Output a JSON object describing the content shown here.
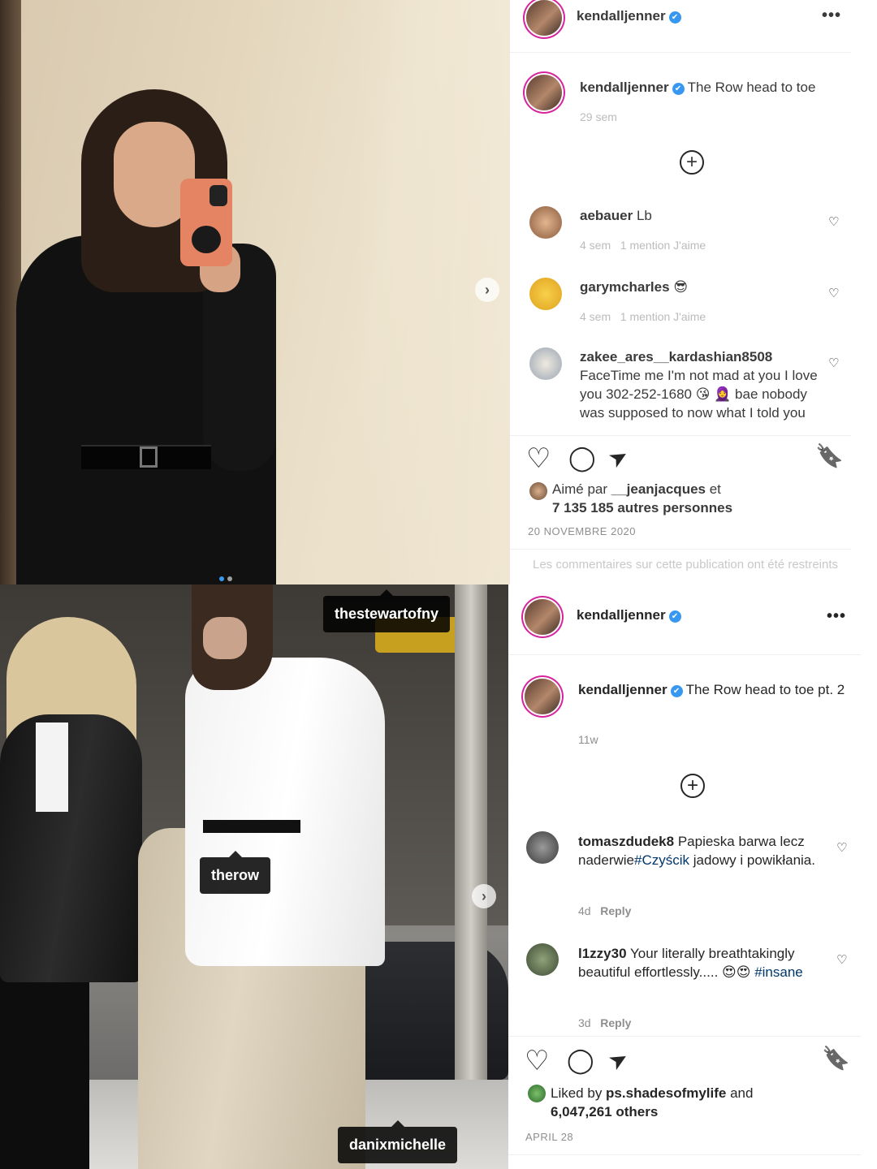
{
  "post1": {
    "header": {
      "username": "kendalljenner",
      "more_label": "•••"
    },
    "caption": {
      "username": "kendalljenner",
      "text": "The Row head to toe",
      "time": "29 sem"
    },
    "add_label": "+",
    "comments": [
      {
        "username": "aebauer",
        "text": "Lb",
        "time": "4 sem",
        "likes": "1 mention J'aime"
      },
      {
        "username": "garymcharles",
        "text": "😎",
        "time": "4 sem",
        "likes": "1 mention J'aime"
      },
      {
        "username": "zakee_ares__kardashian8508",
        "text": "FaceTime me I'm not mad at you I love you 302-252-1680 😘 🧕 bae nobody was supposed to now what I told you"
      }
    ],
    "likes": {
      "prefix": "Aimé par ",
      "user": "__jeanjacques",
      "suffix": " et",
      "count": "7 135 185 autres personnes"
    },
    "date": "20 NOVEMBRE 2020",
    "restricted": "Les commentaires sur cette publication ont été restreints"
  },
  "post2": {
    "header": {
      "username": "kendalljenner",
      "more_label": "•••"
    },
    "caption": {
      "username": "kendalljenner",
      "text": "The Row head to toe pt. 2",
      "time": "11w"
    },
    "add_label": "+",
    "comments": [
      {
        "username": "tomaszdudek8",
        "text_before": "Papieska barwa lecz naderwie",
        "hashtag": "#Czyścik",
        "text_after": " jadowy i powikłania.",
        "time": "4d",
        "reply": "Reply"
      },
      {
        "username": "l1zzy30",
        "text_before": "Your literally breathtakingly beautiful effortlessly..... 😍😍 ",
        "hashtag": "#insane",
        "time": "3d",
        "reply": "Reply"
      }
    ],
    "likes": {
      "prefix": "Liked by ",
      "user": "ps.shadesofmylife",
      "suffix": " and",
      "count": "6,047,261 others"
    },
    "date": "APRIL 28"
  },
  "tags": [
    "thestewartofny",
    "therow",
    "danixmichelle"
  ],
  "icons": {
    "verified": "✔",
    "heart": "♡",
    "comment": "◯",
    "share": "➤",
    "save": "🔖",
    "next": "›"
  },
  "colors": {
    "verified": "#3897f0",
    "hashtag": "#00376b",
    "ring": "#d6249f"
  }
}
